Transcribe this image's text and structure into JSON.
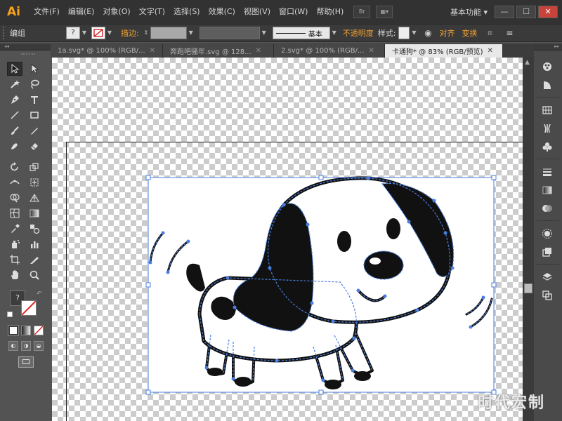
{
  "app": {
    "logo": "Ai",
    "menus": [
      "文件(F)",
      "编辑(E)",
      "对象(O)",
      "文字(T)",
      "选择(S)",
      "效果(C)",
      "视图(V)",
      "窗口(W)",
      "帮助(H)"
    ],
    "bridge_label": "Br",
    "workspace": "基本功能",
    "window_buttons": {
      "minimize": "—",
      "maximize": "☐",
      "close": "✕"
    }
  },
  "control_bar": {
    "selection_type": "编组",
    "fill_swatch": "?",
    "stroke_label": "描边:",
    "stroke_style": "基本",
    "opacity_label": "不透明度",
    "style_label": "样式:",
    "align_label": "对齐",
    "transform_label": "变换"
  },
  "tabs": [
    {
      "label": "1a.svg* @ 100% (RGB/...",
      "active": false
    },
    {
      "label": "奔跑吧骚年.svg @ 128...",
      "active": false
    },
    {
      "label": "2.svg* @ 100% (RGB/...",
      "active": false
    },
    {
      "label": "卡通狗* @ 83% (RGB/预览)",
      "active": true
    }
  ],
  "tools_panel": {
    "unknown_fill": "?"
  },
  "colors": {
    "accent_orange": "#f0a030",
    "selection_blue": "#4a7fe0",
    "ui_dark": "#323232"
  },
  "watermark": "时代宏制"
}
